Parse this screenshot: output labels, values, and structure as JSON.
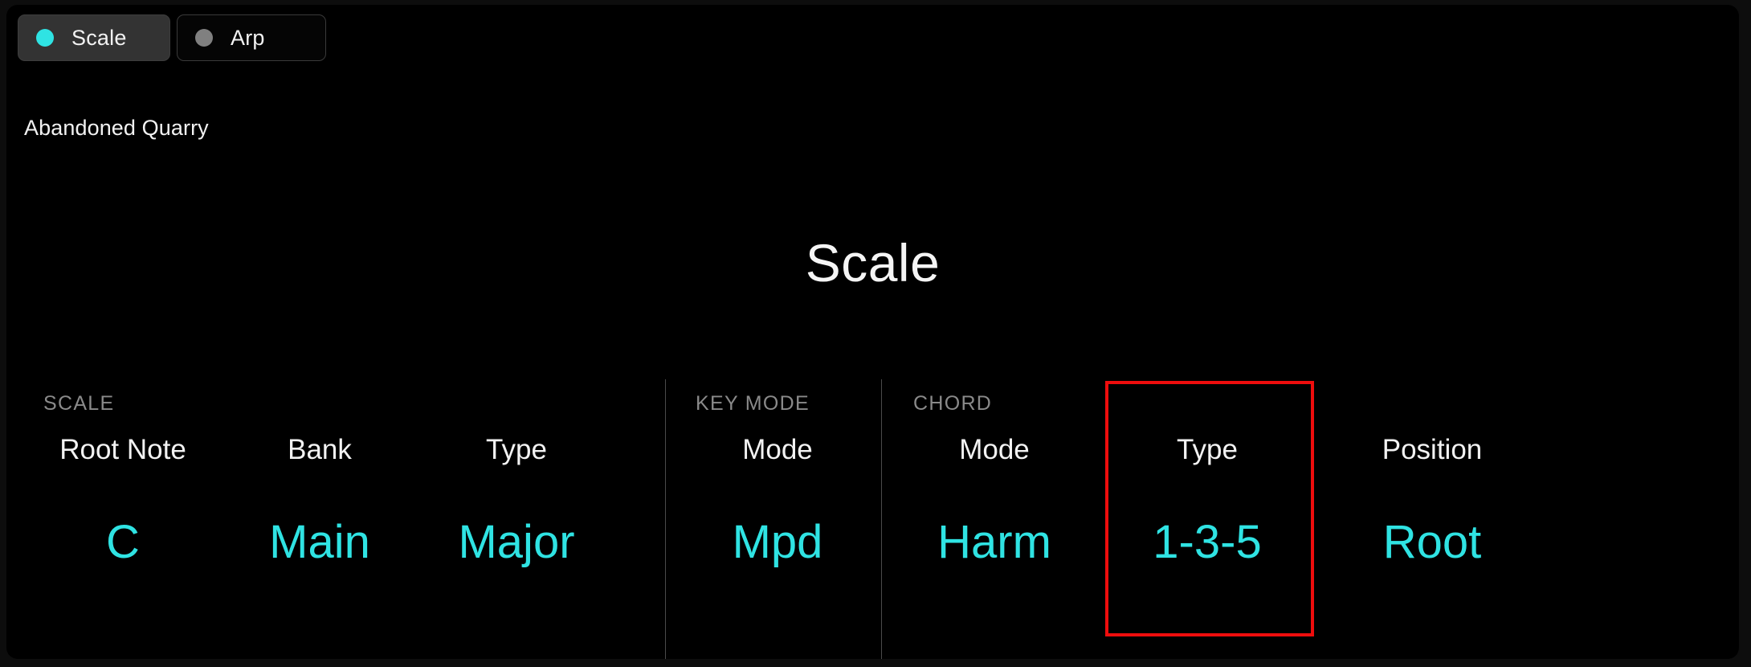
{
  "app": {
    "background_color": "#000000",
    "accent_color": "#2fe3e3",
    "highlight_color": "#ee0d0d"
  },
  "tabs": [
    {
      "label": "Scale",
      "dot": "status-dot",
      "dot_color": "#2fe3e3",
      "active": true
    },
    {
      "label": "Arp",
      "dot": "status-dot",
      "dot_color": "#808080",
      "active": false
    }
  ],
  "preset": {
    "name": "Abandoned Quarry"
  },
  "page": {
    "title": "Scale"
  },
  "groups": [
    {
      "label": "SCALE"
    },
    {
      "label": "KEY MODE"
    },
    {
      "label": "CHORD"
    }
  ],
  "parameters": [
    {
      "label": "Root Note",
      "value": "C",
      "group": "SCALE",
      "highlighted": false
    },
    {
      "label": "Bank",
      "value": "Main",
      "group": "SCALE",
      "highlighted": false
    },
    {
      "label": "Type",
      "value": "Major",
      "group": "SCALE",
      "highlighted": false
    },
    {
      "label": "Mode",
      "value": "Mpd",
      "group": "KEY MODE",
      "highlighted": false
    },
    {
      "label": "Mode",
      "value": "Harm",
      "group": "CHORD",
      "highlighted": false
    },
    {
      "label": "Type",
      "value": "1-3-5",
      "group": "CHORD",
      "highlighted": true
    },
    {
      "label": "Position",
      "value": "Root",
      "group": "CHORD",
      "highlighted": false
    }
  ]
}
